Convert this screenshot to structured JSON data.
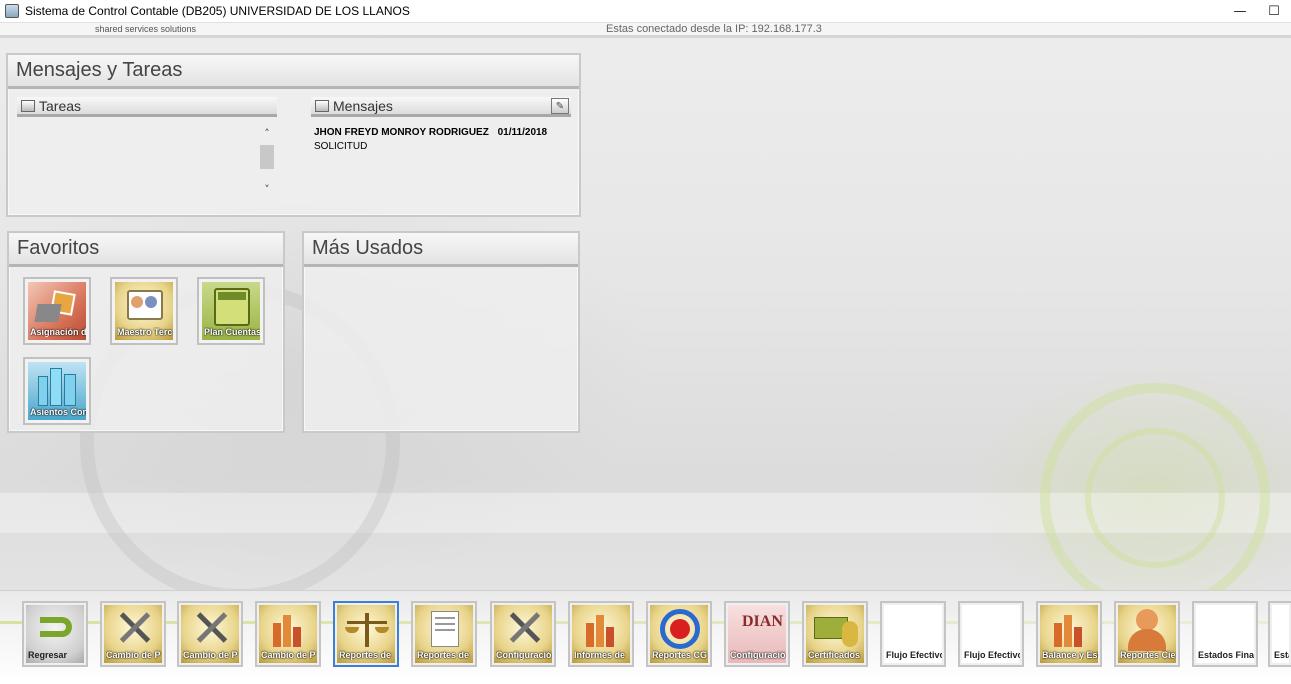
{
  "window": {
    "title": "Sistema de Control Contable (DB205) UNIVERSIDAD DE LOS LLANOS",
    "minimize": "—",
    "maximize": "☐"
  },
  "header": {
    "brand_subtitle": "shared services solutions",
    "ip_text": "Estas conectado desde la IP: 192.168.177.3"
  },
  "mensajes_tareas": {
    "title": "Mensajes y Tareas",
    "tareas_label": "Tareas",
    "mensajes_label": "Mensajes",
    "messages": [
      {
        "sender": "JHON FREYD MONROY RODRIGUEZ",
        "date": "01/11/2018",
        "subject": "SOLICITUD"
      }
    ]
  },
  "favoritos": {
    "title": "Favoritos",
    "items": [
      {
        "label": "Asignación d",
        "icon": "asignacion-icon"
      },
      {
        "label": "Maestro Terc",
        "icon": "maestro-terceros-icon"
      },
      {
        "label": "Plan Cuentas",
        "icon": "calculator-icon"
      },
      {
        "label": "Asientos Con",
        "icon": "buildings-icon"
      }
    ]
  },
  "mas_usados": {
    "title": "Más Usados"
  },
  "toolbar": {
    "items": [
      {
        "label": "Regresar",
        "icon": "back-arrow-icon"
      },
      {
        "label": "Cambio de P",
        "icon": "tools-check-icon"
      },
      {
        "label": "Cambio de P",
        "icon": "tools-check-icon"
      },
      {
        "label": "Cambio de P",
        "icon": "chart-check-icon"
      },
      {
        "label": "Reportes de",
        "icon": "scales-icon"
      },
      {
        "label": "Reportes de",
        "icon": "document-check-icon"
      },
      {
        "label": "Configuració",
        "icon": "tools-check-icon"
      },
      {
        "label": "Informes de",
        "icon": "chart-check-icon"
      },
      {
        "label": "Reportes CG",
        "icon": "target-icon"
      },
      {
        "label": "Configuració",
        "icon": "dian-icon"
      },
      {
        "label": "Certificados",
        "icon": "money-icon"
      },
      {
        "label": "Flujo Efectivo",
        "icon": ""
      },
      {
        "label": "Flujo Efectivo",
        "icon": ""
      },
      {
        "label": "Balance y Est",
        "icon": "chart-check-icon"
      },
      {
        "label": "Reportes Cie",
        "icon": "user-tools-icon"
      },
      {
        "label": "Estados Finan",
        "icon": ""
      },
      {
        "label": "Esta",
        "icon": ""
      }
    ]
  }
}
